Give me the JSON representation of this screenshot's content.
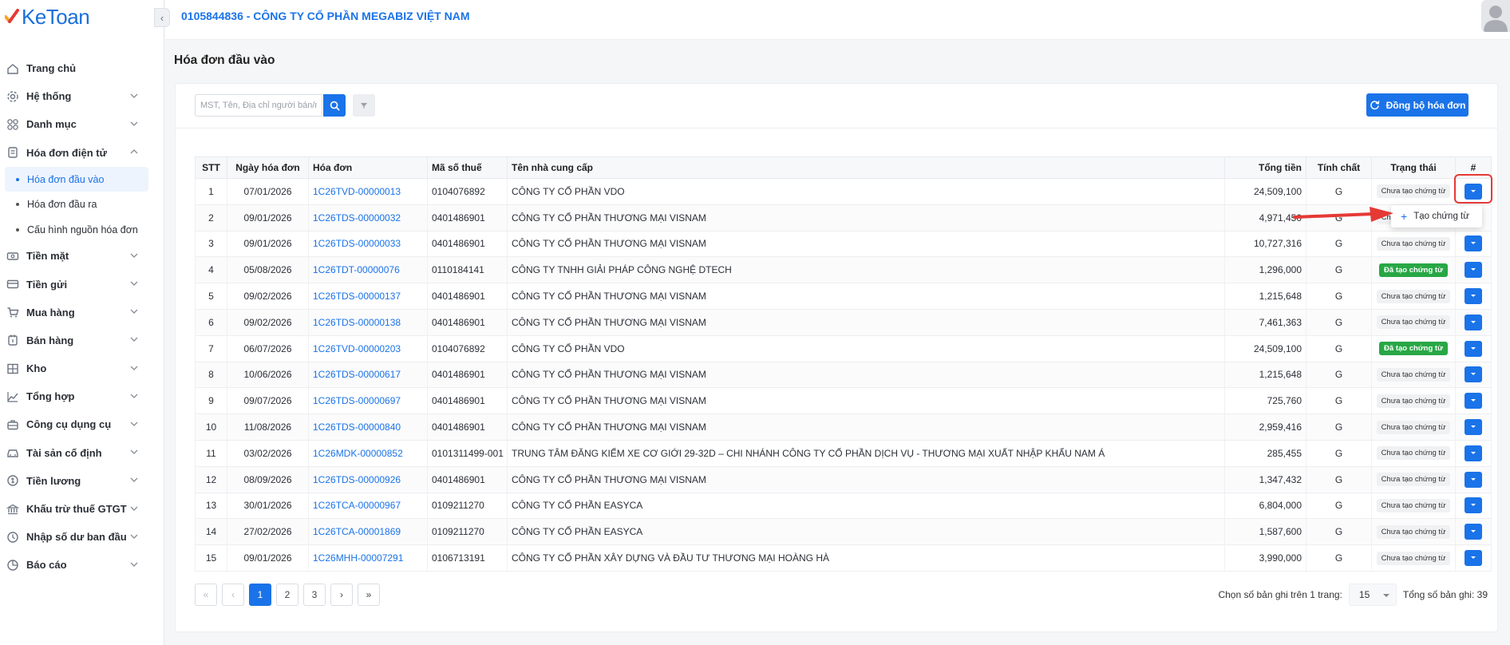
{
  "app": {
    "logo_text": "KeToan"
  },
  "header": {
    "company": "0105844836 - CÔNG TY CỔ PHẦN MEGABIZ VIỆT NAM"
  },
  "sidebar": {
    "items": [
      {
        "label": "Trang chủ",
        "icon": "home-icon"
      },
      {
        "label": "Hệ thống",
        "icon": "gear-icon"
      },
      {
        "label": "Danh mục",
        "icon": "grid-icon"
      },
      {
        "label": "Hóa đơn điện tử",
        "icon": "document-icon",
        "expanded": true,
        "children": [
          {
            "label": "Hóa đơn đầu vào",
            "active": true
          },
          {
            "label": "Hóa đơn đầu ra"
          },
          {
            "label": "Cấu hình nguồn hóa đơn"
          }
        ]
      },
      {
        "label": "Tiền mặt",
        "icon": "cash-icon"
      },
      {
        "label": "Tiền gửi",
        "icon": "bank-card-icon"
      },
      {
        "label": "Mua hàng",
        "icon": "cart-icon"
      },
      {
        "label": "Bán hàng",
        "icon": "sale-icon"
      },
      {
        "label": "Kho",
        "icon": "warehouse-icon"
      },
      {
        "label": "Tổng hợp",
        "icon": "chart-icon"
      },
      {
        "label": "Công cụ dụng cụ",
        "icon": "toolbox-icon"
      },
      {
        "label": "Tài sản cố định",
        "icon": "car-icon"
      },
      {
        "label": "Tiền lương",
        "icon": "salary-icon"
      },
      {
        "label": "Khấu trừ thuế GTGT",
        "icon": "tax-icon"
      },
      {
        "label": "Nhập số dư ban đầu",
        "icon": "balance-icon"
      },
      {
        "label": "Báo cáo",
        "icon": "report-icon"
      }
    ]
  },
  "page": {
    "title": "Hóa đơn đầu vào"
  },
  "toolbar": {
    "search_placeholder": "MST, Tên, Địa chỉ người bán/người mua",
    "sync_label": "Đồng bộ hóa đơn"
  },
  "table": {
    "columns": [
      "STT",
      "Ngày hóa đơn",
      "Hóa đơn",
      "Mã số thuế",
      "Tên nhà cung cấp",
      "Tổng tiền",
      "Tính chất",
      "Trạng thái",
      "#"
    ],
    "rows": [
      {
        "stt": "1",
        "date": "07/01/2026",
        "invoice": "1C26TVD-00000013",
        "tax": "0104076892",
        "supplier": "CÔNG TY CỔ PHẦN VDO",
        "total": "24,509,100",
        "nature": "G",
        "status": "Chưa tạo chứng từ",
        "done": false
      },
      {
        "stt": "2",
        "date": "09/01/2026",
        "invoice": "1C26TDS-00000032",
        "tax": "0401486901",
        "supplier": "CÔNG TY CỔ PHẦN THƯƠNG MẠI VISNAM",
        "total": "4,971,450",
        "nature": "G",
        "status": "Chưa tạo chứng từ",
        "done": false
      },
      {
        "stt": "3",
        "date": "09/01/2026",
        "invoice": "1C26TDS-00000033",
        "tax": "0401486901",
        "supplier": "CÔNG TY CỔ PHẦN THƯƠNG MẠI VISNAM",
        "total": "10,727,316",
        "nature": "G",
        "status": "Chưa tạo chứng từ",
        "done": false
      },
      {
        "stt": "4",
        "date": "05/08/2026",
        "invoice": "1C26TDT-00000076",
        "tax": "0110184141",
        "supplier": "CÔNG TY TNHH GIẢI PHÁP CÔNG NGHỆ DTECH",
        "total": "1,296,000",
        "nature": "G",
        "status": "Đã tạo chứng từ",
        "done": true
      },
      {
        "stt": "5",
        "date": "09/02/2026",
        "invoice": "1C26TDS-00000137",
        "tax": "0401486901",
        "supplier": "CÔNG TY CỔ PHẦN THƯƠNG MẠI VISNAM",
        "total": "1,215,648",
        "nature": "G",
        "status": "Chưa tạo chứng từ",
        "done": false
      },
      {
        "stt": "6",
        "date": "09/02/2026",
        "invoice": "1C26TDS-00000138",
        "tax": "0401486901",
        "supplier": "CÔNG TY CỔ PHẦN THƯƠNG MẠI VISNAM",
        "total": "7,461,363",
        "nature": "G",
        "status": "Chưa tạo chứng từ",
        "done": false
      },
      {
        "stt": "7",
        "date": "06/07/2026",
        "invoice": "1C26TVD-00000203",
        "tax": "0104076892",
        "supplier": "CÔNG TY CỔ PHẦN VDO",
        "total": "24,509,100",
        "nature": "G",
        "status": "Đã tạo chứng từ",
        "done": true
      },
      {
        "stt": "8",
        "date": "10/06/2026",
        "invoice": "1C26TDS-00000617",
        "tax": "0401486901",
        "supplier": "CÔNG TY CỔ PHẦN THƯƠNG MẠI VISNAM",
        "total": "1,215,648",
        "nature": "G",
        "status": "Chưa tạo chứng từ",
        "done": false
      },
      {
        "stt": "9",
        "date": "09/07/2026",
        "invoice": "1C26TDS-00000697",
        "tax": "0401486901",
        "supplier": "CÔNG TY CỔ PHẦN THƯƠNG MẠI VISNAM",
        "total": "725,760",
        "nature": "G",
        "status": "Chưa tạo chứng từ",
        "done": false
      },
      {
        "stt": "10",
        "date": "11/08/2026",
        "invoice": "1C26TDS-00000840",
        "tax": "0401486901",
        "supplier": "CÔNG TY CỔ PHẦN THƯƠNG MẠI VISNAM",
        "total": "2,959,416",
        "nature": "G",
        "status": "Chưa tạo chứng từ",
        "done": false
      },
      {
        "stt": "11",
        "date": "03/02/2026",
        "invoice": "1C26MDK-00000852",
        "tax": "0101311499-001",
        "supplier": "TRUNG TÂM ĐĂNG KIỂM XE CƠ GIỚI 29-32D – CHI NHÁNH CÔNG TY CỔ PHẦN DỊCH VỤ - THƯƠNG MẠI XUẤT NHẬP KHẨU NAM Á",
        "total": "285,455",
        "nature": "G",
        "status": "Chưa tạo chứng từ",
        "done": false
      },
      {
        "stt": "12",
        "date": "08/09/2026",
        "invoice": "1C26TDS-00000926",
        "tax": "0401486901",
        "supplier": "CÔNG TY CỔ PHẦN THƯƠNG MẠI VISNAM",
        "total": "1,347,432",
        "nature": "G",
        "status": "Chưa tạo chứng từ",
        "done": false
      },
      {
        "stt": "13",
        "date": "30/01/2026",
        "invoice": "1C26TCA-00000967",
        "tax": "0109211270",
        "supplier": "CÔNG TY CỔ PHẦN EASYCA",
        "total": "6,804,000",
        "nature": "G",
        "status": "Chưa tạo chứng từ",
        "done": false
      },
      {
        "stt": "14",
        "date": "27/02/2026",
        "invoice": "1C26TCA-00001869",
        "tax": "0109211270",
        "supplier": "CÔNG TY CỔ PHẦN EASYCA",
        "total": "1,587,600",
        "nature": "G",
        "status": "Chưa tạo chứng từ",
        "done": false
      },
      {
        "stt": "15",
        "date": "09/01/2026",
        "invoice": "1C26MHH-00007291",
        "tax": "0106713191",
        "supplier": "CÔNG TY CỔ PHẦN XÂY DỰNG VÀ ĐẦU TƯ THƯƠNG MẠI HOÀNG HÀ",
        "total": "3,990,000",
        "nature": "G",
        "status": "Chưa tạo chứng từ",
        "done": false
      }
    ]
  },
  "dropdown": {
    "item_label": "Tạo chứng từ"
  },
  "pagination": {
    "pages": [
      "1",
      "2",
      "3"
    ],
    "current": "1",
    "page_size_label": "Chọn số bản ghi trên 1 trang:",
    "page_size": "15",
    "total_label": "Tổng số bản ghi:",
    "total": "39"
  },
  "colors": {
    "primary": "#1a73e8",
    "success": "#28a745",
    "highlight": "#e53935"
  }
}
